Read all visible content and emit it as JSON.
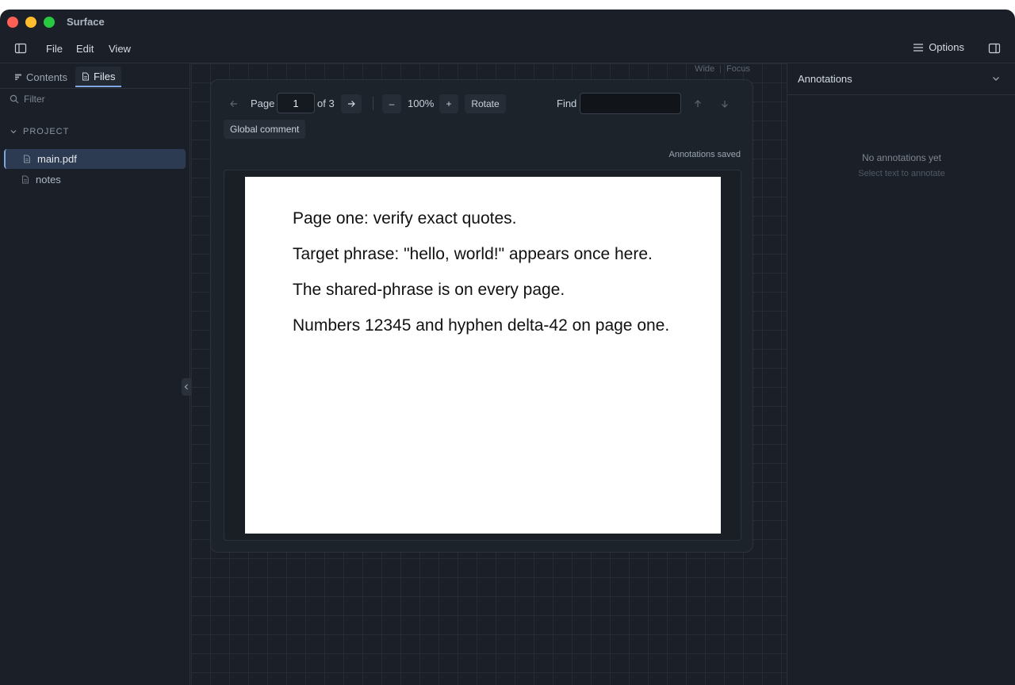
{
  "app": {
    "title": "Surface"
  },
  "menu": {
    "file": "File",
    "edit": "Edit",
    "view": "View",
    "options": "Options"
  },
  "sidebar": {
    "tabs": [
      {
        "label": "Contents"
      },
      {
        "label": "Files"
      }
    ],
    "active_tab": "Files",
    "filter_placeholder": "Filter",
    "section_label": "PROJECT",
    "files": [
      {
        "name": "main.pdf",
        "selected": true
      },
      {
        "name": "notes",
        "selected": false
      }
    ]
  },
  "view_modes": {
    "wide": "Wide",
    "separator": "|",
    "focus": "Focus"
  },
  "toolbar": {
    "page_label": "Page",
    "page_value": "1",
    "page_total": "of 3",
    "zoom_out": "–",
    "zoom_level": "100%",
    "zoom_in": "+",
    "rotate": "Rotate",
    "find_label": "Find",
    "find_value": ""
  },
  "global_comment": "Global comment",
  "status": "Annotations saved",
  "pdf": {
    "lines": [
      "Page one: verify exact quotes.",
      "Target phrase: \"hello, world!\" appears once here.",
      "The shared-phrase is on every page.",
      "Numbers 12345 and hyphen delta-42 on page one."
    ]
  },
  "annotations_panel": {
    "title": "Annotations",
    "empty_title": "No annotations yet",
    "empty_subtitle": "Select text to annotate"
  },
  "colors": {
    "window_bg": "#1b2028",
    "accent": "#7ea6e0",
    "selected_row": "#2c3a52",
    "traffic_red": "#fe5f57",
    "traffic_yellow": "#febc2e",
    "traffic_green": "#28c840"
  }
}
